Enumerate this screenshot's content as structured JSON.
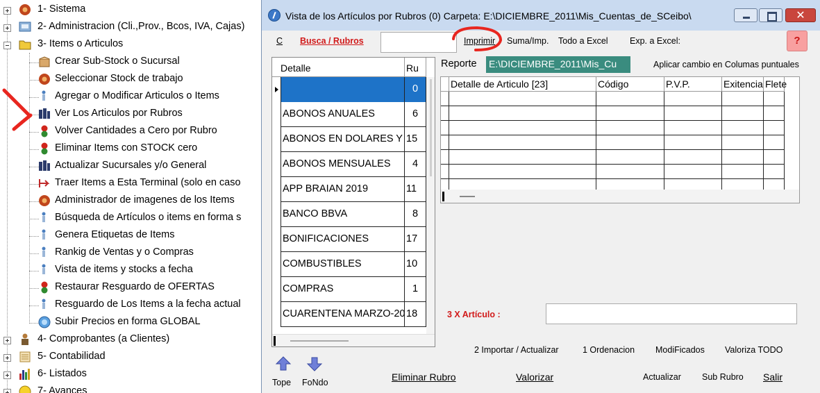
{
  "tree": {
    "items": [
      {
        "label": "1- Sistema",
        "icon": "gear-icon"
      },
      {
        "label": "2- Administracion (Cli.,Prov., Bcos, IVA, Cajas)",
        "icon": "admin-icon"
      },
      {
        "label": "3- Items o Articulos",
        "icon": "folder-icon"
      },
      {
        "label": "Crear Sub-Stock o Sucursal",
        "icon": "box-icon"
      },
      {
        "label": "Seleccionar Stock de trabajo",
        "icon": "gear-icon"
      },
      {
        "label": "Agregar o Modificar Articulos o Items",
        "icon": "figure-icon"
      },
      {
        "label": "Ver Los Articulos por Rubros",
        "icon": "people-icon"
      },
      {
        "label": "Volver Cantidades a Cero por Rubro",
        "icon": "traffic-light-icon"
      },
      {
        "label": "Eliminar Items con STOCK cero",
        "icon": "traffic-light-icon"
      },
      {
        "label": "Actualizar Sucursales y/o  General",
        "icon": "people-icon"
      },
      {
        "label": "Traer Items a Esta Terminal (solo en caso",
        "icon": "transfer-icon"
      },
      {
        "label": "Administrador de imagenes de los Items",
        "icon": "gear-icon"
      },
      {
        "label": "Búsqueda de Artículos o items  en forma s",
        "icon": "figure-icon"
      },
      {
        "label": "Genera Etiquetas de Items",
        "icon": "figure-icon"
      },
      {
        "label": "Rankig de Ventas y o Compras",
        "icon": "figure-icon"
      },
      {
        "label": "Vista de items y stocks a fecha",
        "icon": "figure-icon"
      },
      {
        "label": "Restaurar Resguardo de OFERTAS",
        "icon": "traffic-light-icon"
      },
      {
        "label": "Resguardo de Los Items a la fecha actual",
        "icon": "figure-icon"
      },
      {
        "label": "Subir Precios en forma GLOBAL",
        "icon": "globe-icon"
      },
      {
        "label": "4- Comprobantes (a Clientes)",
        "icon": "person-icon"
      },
      {
        "label": "5- Contabilidad",
        "icon": "ledger-icon"
      },
      {
        "label": "6- Listados",
        "icon": "bar-chart-icon"
      },
      {
        "label": "7- Avances",
        "icon": "smiley-icon"
      }
    ]
  },
  "window": {
    "title": "Vista de los Artículos por Rubros (0) Carpeta: E:\\DICIEMBRE_2011\\Mis_Cuentas_de_SCeibo\\",
    "close_glyph": "✕"
  },
  "toolbar": {
    "c_label": "C",
    "busca": "Busca / Rubros",
    "imprimir": "Imprimir",
    "suma": "Suma/Imp.",
    "todo_excel": "Todo a Excel",
    "exp_excel": "Exp. a Excel:",
    "help": "?"
  },
  "rubros": {
    "headers": [
      "Detalle",
      "Ru"
    ],
    "rows": [
      {
        "detalle": "",
        "ru": "0"
      },
      {
        "detalle": "ABONOS ANUALES",
        "ru": "6"
      },
      {
        "detalle": "ABONOS EN DOLARES Y",
        "ru": "15"
      },
      {
        "detalle": "ABONOS MENSUALES",
        "ru": "4"
      },
      {
        "detalle": "APP BRAIAN 2019",
        "ru": "11"
      },
      {
        "detalle": "BANCO BBVA",
        "ru": "8"
      },
      {
        "detalle": "BONIFICACIONES",
        "ru": "17"
      },
      {
        "detalle": "COMBUSTIBLES",
        "ru": "10"
      },
      {
        "detalle": "COMPRAS",
        "ru": "1"
      },
      {
        "detalle": "CUARENTENA MARZO-20",
        "ru": "18"
      }
    ]
  },
  "reporte": {
    "label": "Reporte",
    "path": "E:\\DICIEMBRE_2011\\Mis_Cu",
    "aplicar": "Aplicar cambio en Columas puntuales"
  },
  "articulos": {
    "headers": [
      "Detalle de Articulo [23]",
      "Código",
      "P.V.P.",
      "Exitencia",
      "Flete"
    ]
  },
  "por_articulo": {
    "label": "3 X Artículo :"
  },
  "bottom": {
    "importar": "2 Importar / Actualizar",
    "ordenacion": "1 Ordenacion",
    "modificados": "ModiFicados",
    "valoriza_todo": "Valoriza TODO",
    "tope": "Tope",
    "fondo": "FoNdo",
    "eliminar_rubro": "Eliminar Rubro",
    "valorizar": "Valorizar",
    "actualizar": "Actualizar",
    "sub_rubro": "Sub Rubro",
    "salir": "Salir"
  },
  "colors": {
    "accent_red": "#d11a1a",
    "selection_blue": "#1e73c8",
    "path_teal": "#3a8c7f",
    "titlebar": "#c9daf0",
    "annotation_red": "#e8261f"
  }
}
